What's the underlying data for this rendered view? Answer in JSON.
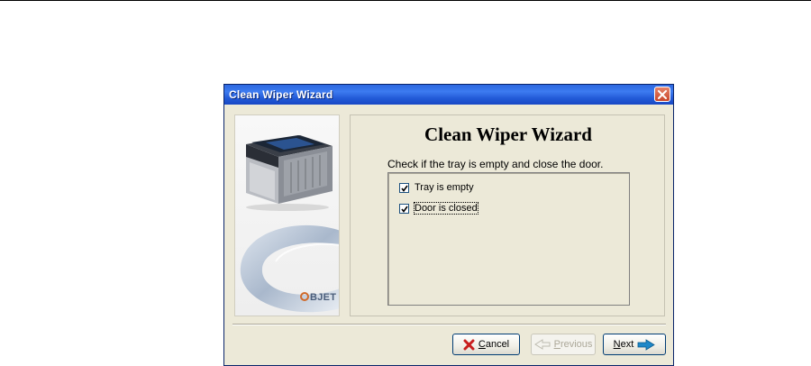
{
  "window": {
    "title": "Clean Wiper Wizard",
    "close_icon": "close-icon"
  },
  "left_panel": {
    "logo_text": "BJET"
  },
  "content": {
    "heading": "Clean Wiper Wizard",
    "instruction": "Check if the tray is empty and close the door.",
    "checkboxes": [
      {
        "label": "Tray is empty",
        "checked": true
      },
      {
        "label": "Door is closed",
        "checked": true
      }
    ]
  },
  "buttons": {
    "cancel": {
      "label": "Cancel",
      "icon": "x-icon",
      "enabled": true
    },
    "previous": {
      "label": "Previous",
      "icon": "left-arrow-icon",
      "enabled": false
    },
    "next": {
      "label": "Next",
      "icon": "right-arrow-icon",
      "enabled": true
    }
  },
  "colors": {
    "titlebar": "#2d68e0",
    "dialog_bg": "#ece9d8",
    "cancel_icon": "#c81e1e",
    "next_arrow": "#1e88c8"
  }
}
